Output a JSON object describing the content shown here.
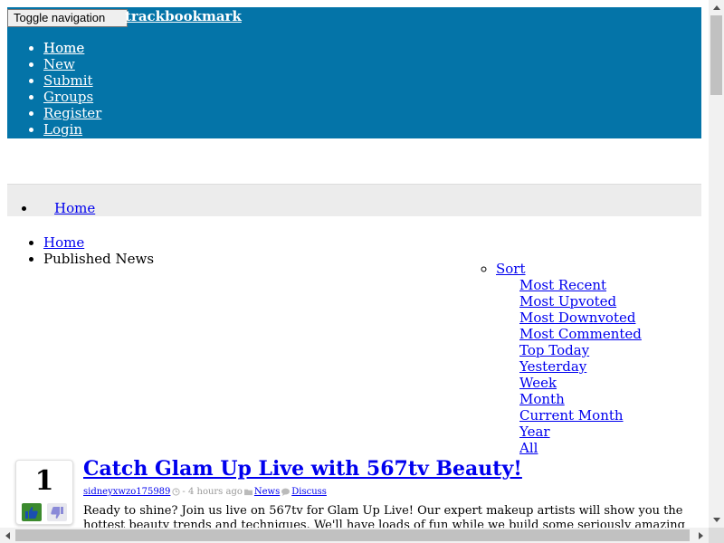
{
  "navbar": {
    "toggle_label": "Toggle navigation",
    "brand": "trackbookmark",
    "items": [
      "Home",
      "New",
      "Submit",
      "Groups",
      "Register",
      "Login"
    ]
  },
  "subnav": {
    "home": "Home"
  },
  "breadcrumb": {
    "home": "Home",
    "current": "Published News"
  },
  "sort": {
    "label": "Sort",
    "options": [
      "Most Recent",
      "Most Upvoted",
      "Most Downvoted",
      "Most Commented",
      "Top Today",
      "Yesterday",
      "Week",
      "Month",
      "Current Month",
      "Year",
      "All"
    ]
  },
  "story": {
    "votes": "1",
    "title": "Catch Glam Up Live with 567tv Beauty!",
    "author": "sidneyxwzo175989",
    "time": "- 4 hours ago",
    "category": "News",
    "discuss": "Discuss",
    "body": "Ready to shine? Join us live on 567tv for Glam Up Live! Our expert makeup artists will show you the hottest beauty trends and techniques. We'll have loads of fun while we build some seriously amazing looks. Don't"
  },
  "colors": {
    "navbar_bg": "#0474a8",
    "subbar_bg": "#ececec",
    "vote_up_bg": "#3b8a2e"
  }
}
